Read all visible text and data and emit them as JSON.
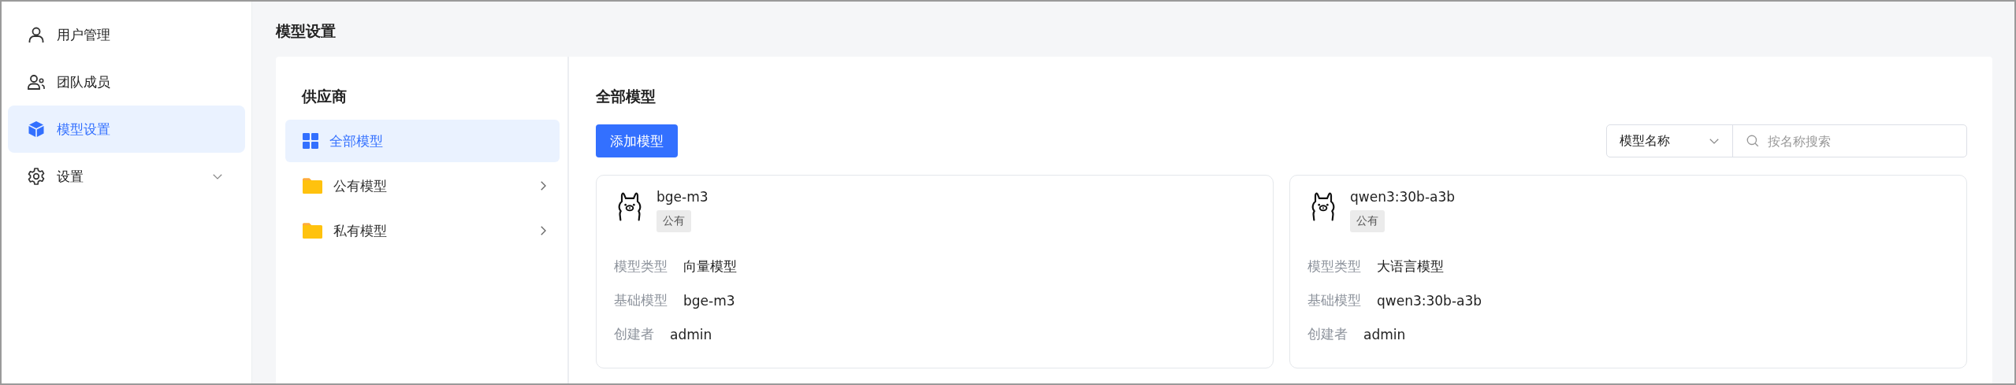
{
  "sidebar": {
    "items": [
      {
        "label": "用户管理",
        "kind": "user",
        "selected": false
      },
      {
        "label": "团队成员",
        "kind": "team",
        "selected": false
      },
      {
        "label": "模型设置",
        "kind": "cube",
        "selected": true
      },
      {
        "label": "设置",
        "kind": "gear",
        "selected": false,
        "expanded": false
      }
    ]
  },
  "page_title": "模型设置",
  "providers": {
    "title": "供应商",
    "items": [
      {
        "label": "全部模型",
        "kind": "all",
        "selected": true
      },
      {
        "label": "公有模型",
        "kind": "folder",
        "selected": false
      },
      {
        "label": "私有模型",
        "kind": "folder",
        "selected": false
      }
    ]
  },
  "models": {
    "title": "全部模型",
    "add_button": "添加模型",
    "filter": {
      "value": "模型名称"
    },
    "search": {
      "placeholder": "按名称搜索"
    },
    "cards": [
      {
        "name": "bge-m3",
        "tag": "公有",
        "fields": [
          {
            "label": "模型类型",
            "value": "向量模型"
          },
          {
            "label": "基础模型",
            "value": "bge-m3"
          },
          {
            "label": "创建者",
            "value": "admin"
          }
        ]
      },
      {
        "name": "qwen3:30b-a3b",
        "tag": "公有",
        "fields": [
          {
            "label": "模型类型",
            "value": "大语言模型"
          },
          {
            "label": "基础模型",
            "value": "qwen3:30b-a3b"
          },
          {
            "label": "创建者",
            "value": "admin"
          }
        ]
      }
    ]
  }
}
